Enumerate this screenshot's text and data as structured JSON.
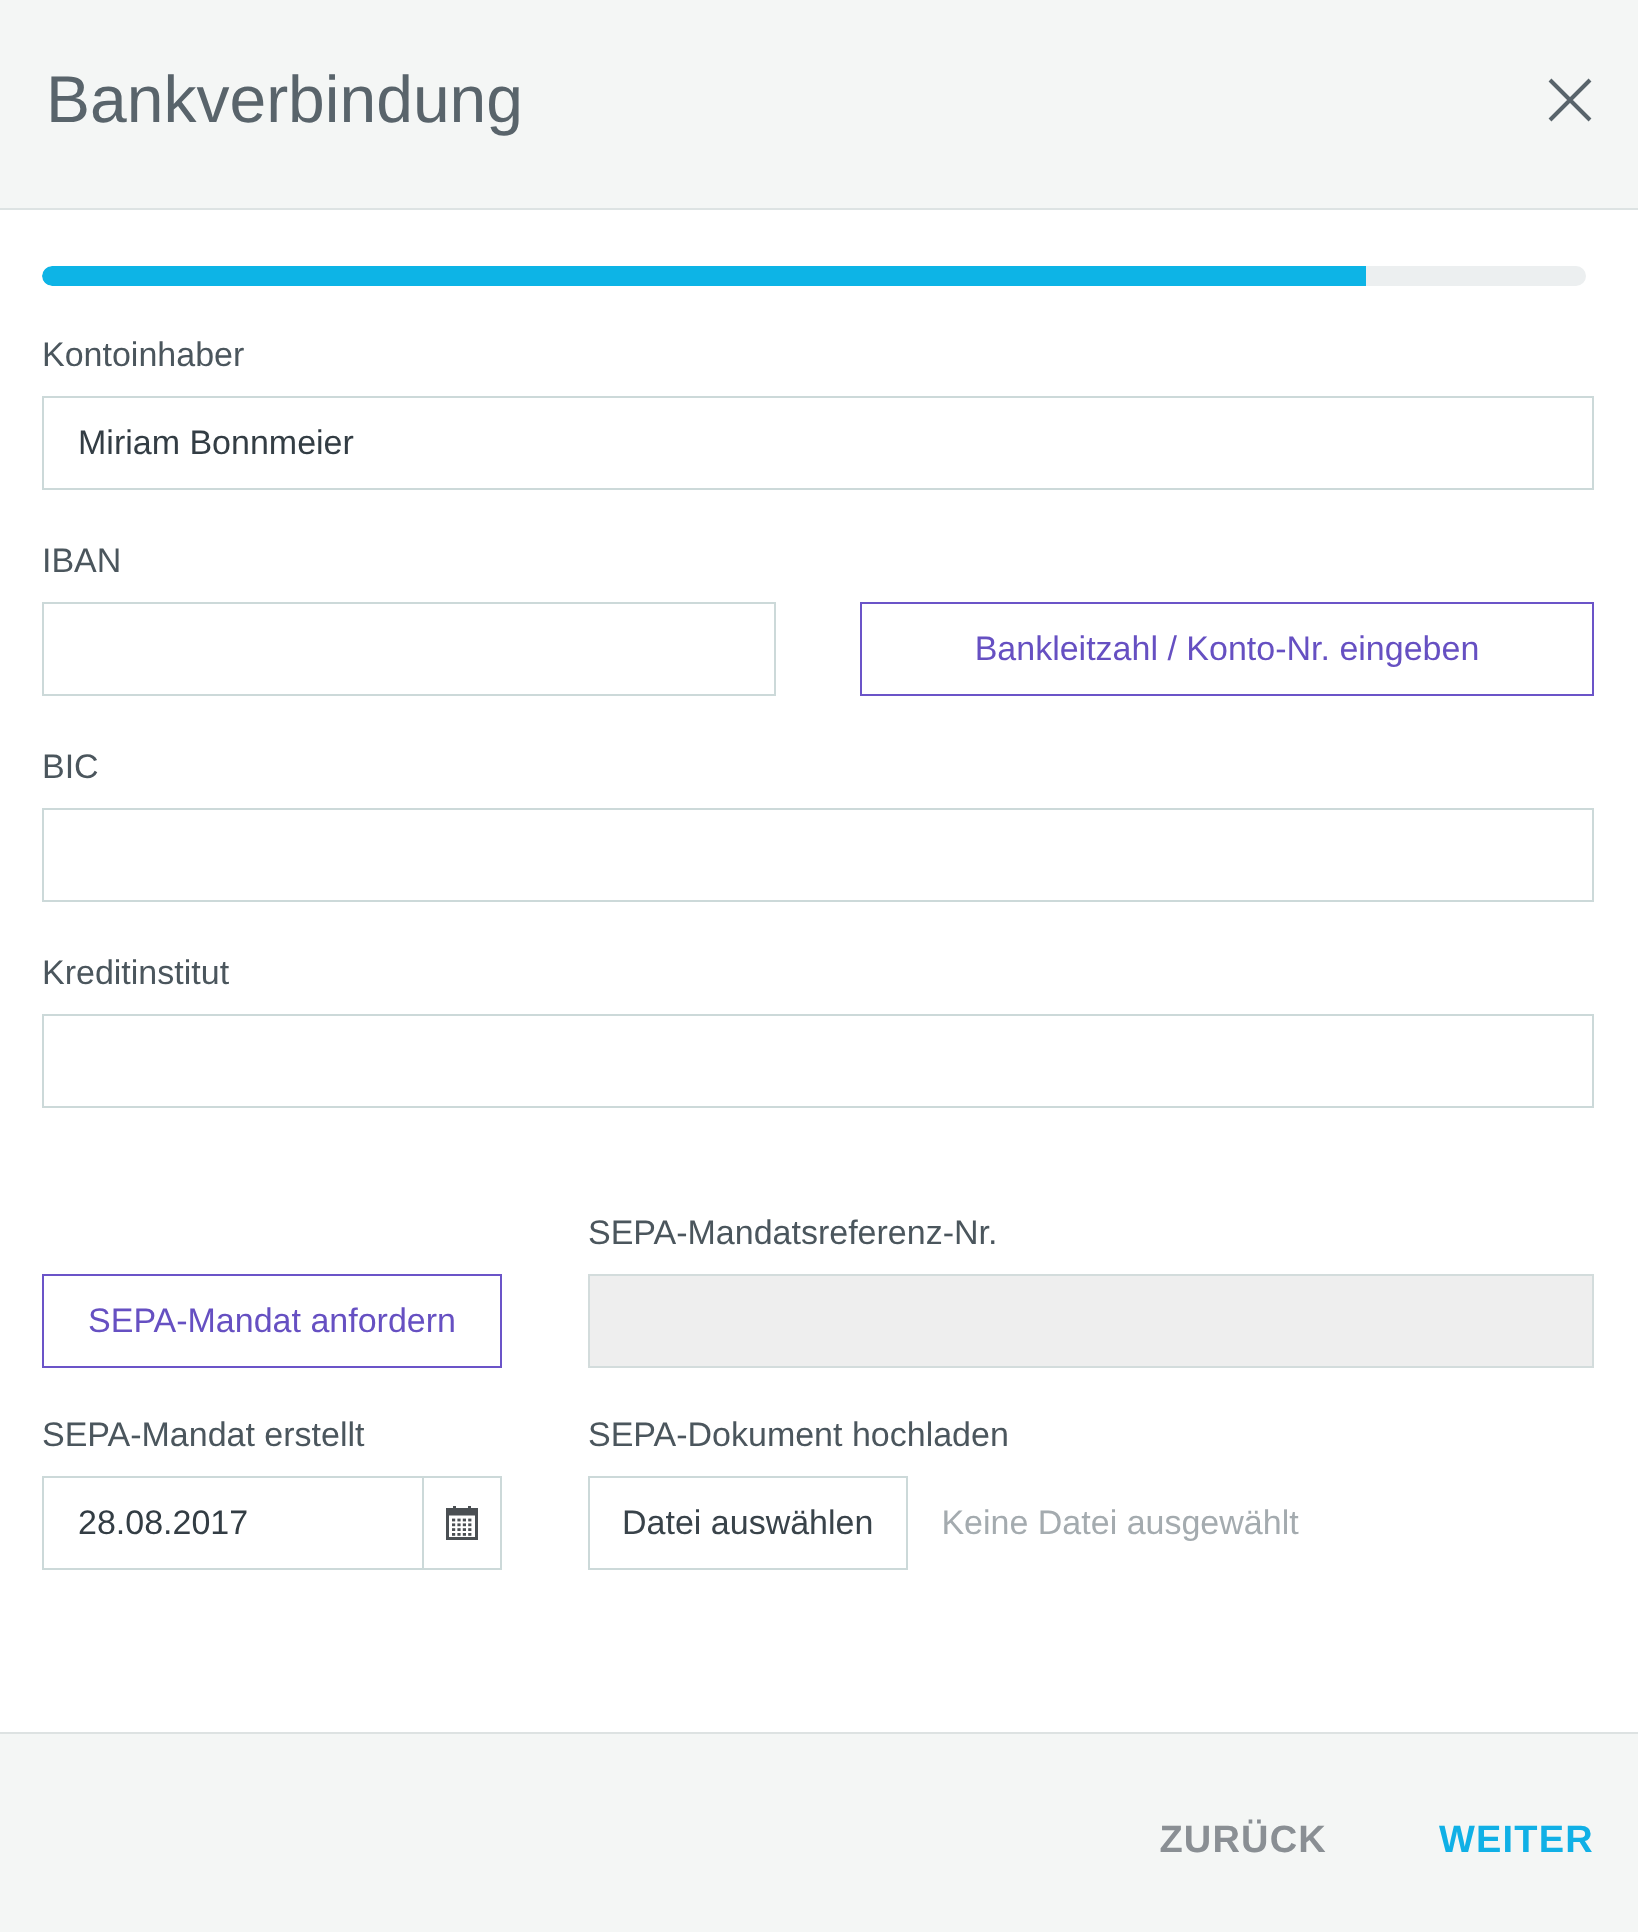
{
  "window": {
    "title": "Bankverbindung"
  },
  "progress": {
    "level": 0.857
  },
  "fields": [
    {
      "kind": "text",
      "label": "Kontoinhaber",
      "value": "Miriam Bonnmeier"
    },
    {
      "kind": "text_with_button",
      "label": "IBAN",
      "button": "Bankleitzahl / Konto-Nr. eingeben"
    },
    {
      "kind": "text",
      "label": "BIC"
    },
    {
      "kind": "text",
      "label": "Kreditinstitut"
    }
  ],
  "sepa": {
    "request_button": "SEPA-Mandat anfordern",
    "reference": {
      "label": "SEPA-Mandatsreferenz-Nr.",
      "disabled": true
    },
    "created": {
      "label": "SEPA-Mandat erstellt",
      "value": "28.08.2017"
    },
    "upload": {
      "label": "SEPA-Dokument hochladen",
      "button": "Datei auswählen",
      "status": "Keine Datei ausgewählt"
    }
  },
  "footer": {
    "buttons": [
      {
        "kind": "secondary",
        "label": "ZURÜCK"
      },
      {
        "kind": "primary",
        "label": "WEITER"
      }
    ]
  }
}
